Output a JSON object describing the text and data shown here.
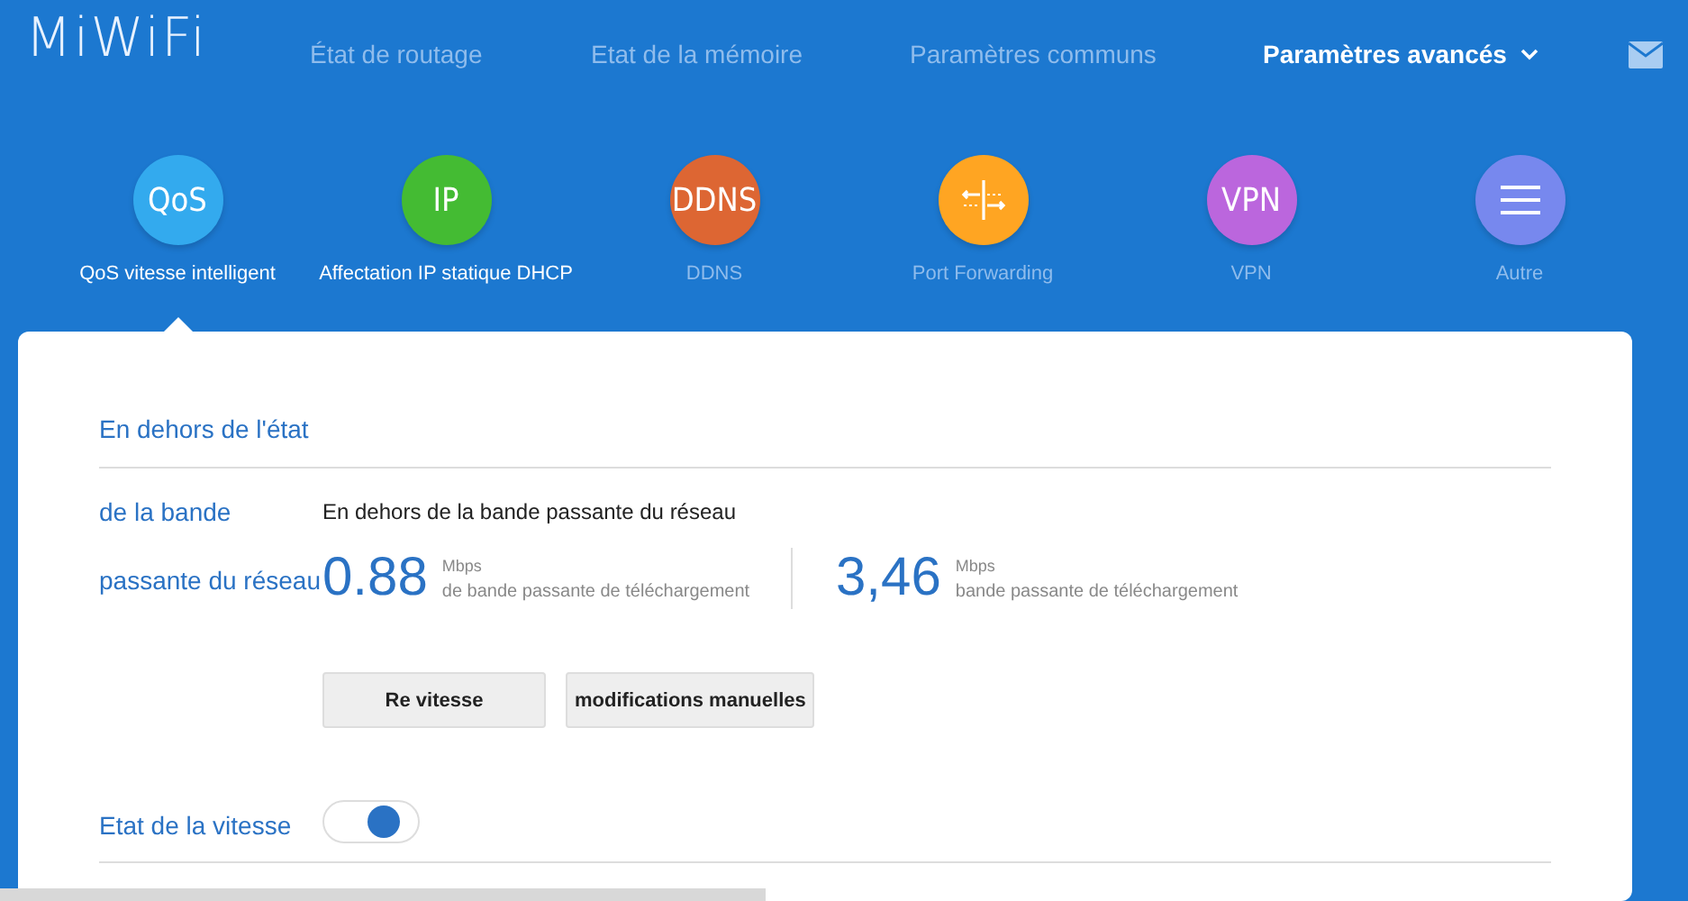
{
  "header": {
    "logo": "MiWiFi",
    "nav": [
      {
        "label": "État de routage",
        "selected": false
      },
      {
        "label": "Etat de la mémoire",
        "selected": false
      },
      {
        "label": "Paramètres communs",
        "selected": false
      },
      {
        "label": "Paramètres avancés",
        "selected": true
      }
    ]
  },
  "features": [
    {
      "kind": "text",
      "icon_text": "QoS",
      "label": "QoS vitesse intelligent",
      "color": "#33aaee",
      "selected": true,
      "disabled": false
    },
    {
      "kind": "text",
      "icon_text": "IP",
      "label": "Affectation IP statique DHCP",
      "color": "#44bb33",
      "selected": false,
      "disabled": false
    },
    {
      "kind": "text",
      "icon_text": "DDNS",
      "label": "DDNS",
      "color": "#dd6633",
      "selected": false,
      "disabled": true
    },
    {
      "kind": "ports",
      "label": "Port Forwarding",
      "color": "#ffa522",
      "selected": false,
      "disabled": true
    },
    {
      "kind": "text",
      "icon_text": "VPN",
      "label": "VPN",
      "color": "#bb66dd",
      "selected": false,
      "disabled": true
    },
    {
      "kind": "menu",
      "label": "Autre",
      "color": "#7788ee",
      "selected": false,
      "disabled": true
    }
  ],
  "card": {
    "title": "En dehors de l'état",
    "section_label_1": "de la bande",
    "section_label_2": "passante du réseau",
    "status_text": "En dehors de la bande passante du réseau",
    "speeds": [
      {
        "value": "0.88",
        "unit": "Mbps",
        "caption": "de bande passante de téléchargement"
      },
      {
        "value": "3,46",
        "unit": "Mbps",
        "caption": "bande passante de téléchargement"
      }
    ],
    "buttons": [
      "Re vitesse",
      "modifications manuelles"
    ],
    "toggle": {
      "label": "Etat de la vitesse",
      "on": true
    }
  }
}
